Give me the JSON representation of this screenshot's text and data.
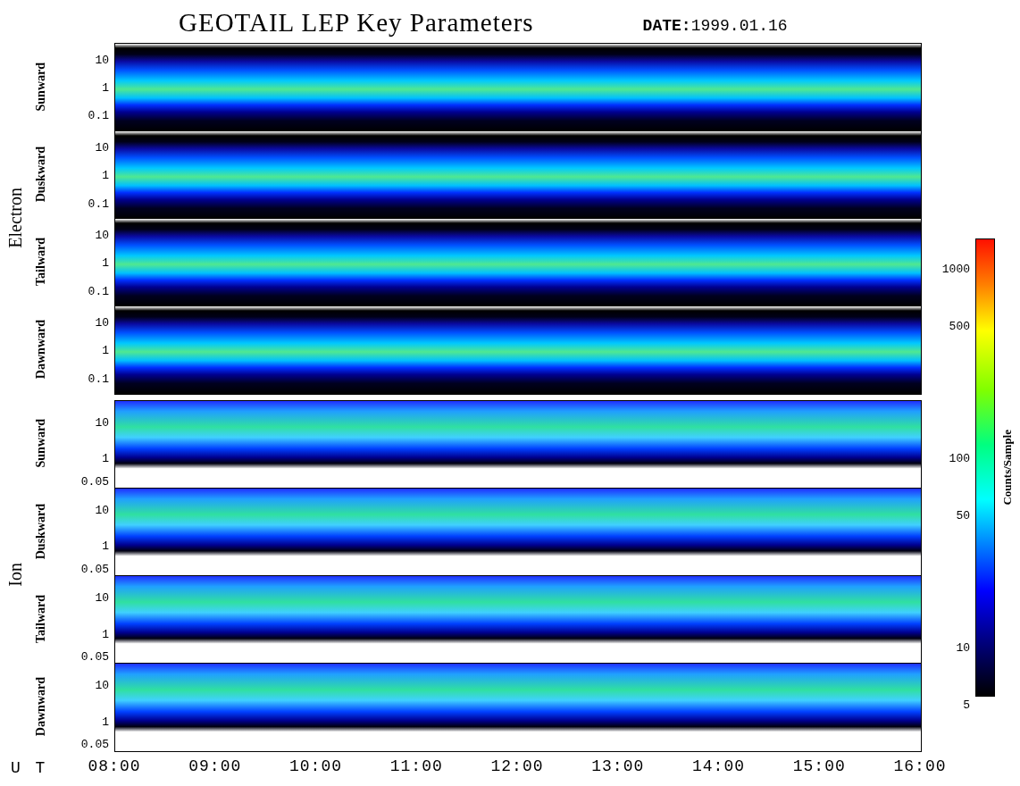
{
  "title": "GEOTAIL LEP Key Parameters",
  "date": "**DATE:**1999.01.16",
  "groups": [
    {
      "label": "Electron",
      "kind": "electron",
      "panels": [
        {
          "label": "Sunward",
          "yticks": [
            "10",
            "1",
            "0.1"
          ]
        },
        {
          "label": "Duskward",
          "yticks": [
            "10",
            "1",
            "0.1"
          ]
        },
        {
          "label": "Tailward",
          "yticks": [
            "10",
            "1",
            "0.1"
          ]
        },
        {
          "label": "Dawnward",
          "yticks": [
            "10",
            "1",
            "0.1"
          ]
        }
      ]
    },
    {
      "label": "Ion",
      "kind": "ion",
      "panels": [
        {
          "label": "Sunward",
          "yticks": [
            "10",
            "1",
            "0.05"
          ]
        },
        {
          "label": "Duskward",
          "yticks": [
            "10",
            "1",
            "0.05"
          ]
        },
        {
          "label": "Tailward",
          "yticks": [
            "10",
            "1",
            "0.05"
          ]
        },
        {
          "label": "Dawnward",
          "yticks": [
            "10",
            "1",
            "0.05"
          ]
        }
      ]
    }
  ],
  "xaxis": {
    "label": "U T",
    "ticks": [
      "08:00",
      "09:00",
      "10:00",
      "11:00",
      "12:00",
      "13:00",
      "14:00",
      "15:00",
      "16:00"
    ]
  },
  "colorbar": {
    "label": "Counts/Sample",
    "ticks": [
      "1000",
      "500",
      "100",
      "50",
      "10",
      "5"
    ]
  }
}
